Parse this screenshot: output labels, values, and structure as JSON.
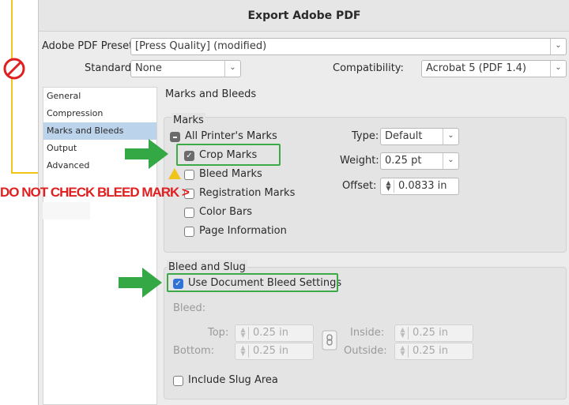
{
  "dialog": {
    "title": "Export Adobe PDF"
  },
  "preset": {
    "label": "Adobe PDF Preset:",
    "value": "[Press Quality] (modified)"
  },
  "standard": {
    "label": "Standard:",
    "value": "None"
  },
  "compatibility": {
    "label": "Compatibility:",
    "value": "Acrobat 5 (PDF 1.4)"
  },
  "sidebar": {
    "items": [
      {
        "label": "General"
      },
      {
        "label": "Compression"
      },
      {
        "label": "Marks and Bleeds"
      },
      {
        "label": "Output"
      },
      {
        "label": "Advanced"
      }
    ]
  },
  "section": {
    "title": "Marks and Bleeds"
  },
  "marks": {
    "title": "Marks",
    "all_printers_marks": "All Printer's Marks",
    "crop_marks": "Crop Marks",
    "bleed_marks": "Bleed Marks",
    "registration_marks": "Registration Marks",
    "color_bars": "Color Bars",
    "page_information": "Page Information",
    "type_label": "Type:",
    "type_value": "Default",
    "weight_label": "Weight:",
    "weight_value": "0.25 pt",
    "offset_label": "Offset:",
    "offset_value": "0.0833 in"
  },
  "bleed_slug": {
    "title": "Bleed and Slug",
    "use_document": "Use Document Bleed Settings",
    "bleed_label": "Bleed:",
    "top_label": "Top:",
    "top_value": "0.25 in",
    "bottom_label": "Bottom:",
    "bottom_value": "0.25 in",
    "inside_label": "Inside:",
    "inside_value": "0.25 in",
    "outside_label": "Outside:",
    "outside_value": "0.25 in",
    "include_slug": "Include Slug Area"
  },
  "annotation": {
    "warning": "DO NOT CHECK BLEED MARK >"
  },
  "colors": {
    "accent_green": "#35a846",
    "warning_red": "#e02020",
    "guide_yellow": "#f0c419",
    "selection": "#bcd3ec"
  }
}
